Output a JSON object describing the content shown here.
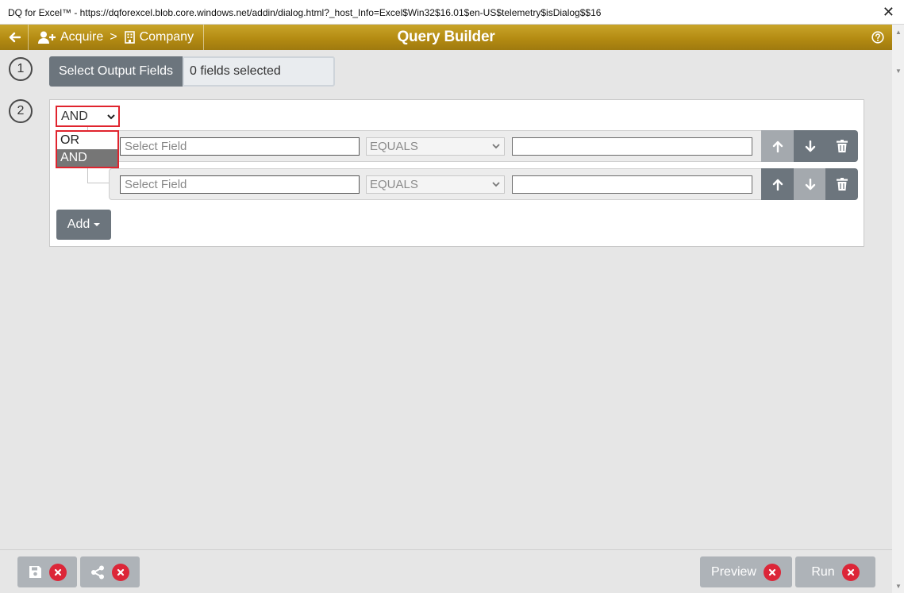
{
  "window": {
    "title": "DQ for Excel™ - https://dqforexcel.blob.core.windows.net/addin/dialog.html?_host_Info=Excel$Win32$16.01$en-US$telemetry$isDialog$$16",
    "close_glyph": "✕"
  },
  "header": {
    "breadcrumb": {
      "first": "Acquire",
      "separator": ">",
      "second": "Company"
    },
    "title": "Query Builder",
    "accent_color": "#b48b12"
  },
  "steps": {
    "one": "1",
    "two": "2"
  },
  "output": {
    "button_label": "Select Output Fields",
    "fields_status": "0 fields selected"
  },
  "group": {
    "combinator": "AND",
    "combinator_options": [
      {
        "label": "OR"
      },
      {
        "label": "AND",
        "selected": true
      }
    ]
  },
  "rules": [
    {
      "field_placeholder": "Select Field",
      "operator": "EQUALS",
      "value": ""
    },
    {
      "field_placeholder": "Select Field",
      "operator": "EQUALS",
      "value": ""
    }
  ],
  "add_button": {
    "label": "Add"
  },
  "footer": {
    "preview_label": "Preview",
    "run_label": "Run"
  },
  "icons": [
    "back-arrow-icon",
    "add-user-icon",
    "building-icon",
    "help-icon",
    "chevron-down-icon",
    "arrow-up-icon",
    "arrow-down-icon",
    "trash-icon",
    "save-icon",
    "share-icon",
    "x-circle-icon"
  ]
}
